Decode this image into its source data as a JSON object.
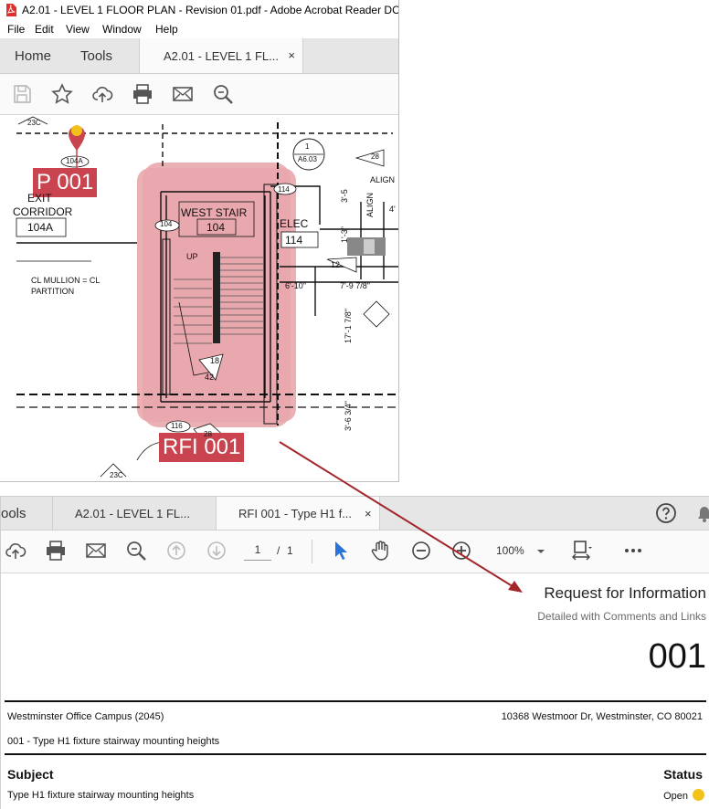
{
  "window1": {
    "title": "A2.01 - LEVEL 1 FLOOR PLAN - Revision 01.pdf - Adobe Acrobat Reader DC",
    "menu": [
      "File",
      "Edit",
      "View",
      "Window",
      "Help"
    ],
    "tabs": {
      "home": "Home",
      "tools": "Tools",
      "doc": "A2.01 - LEVEL 1 FL...",
      "close": "×"
    },
    "toolbar_icons": [
      "save-icon",
      "star-icon",
      "cloud-upload-icon",
      "print-icon",
      "mail-icon",
      "search-zoom-icon"
    ],
    "plan": {
      "markup_p": "P 001",
      "markup_rfi": "RFI 001",
      "pin_tag": "104A",
      "exit_label_1": "EXIT",
      "exit_label_2": "CORRIDOR",
      "exit_room": "104A",
      "tag_104": "104",
      "stair_name": "WEST STAIR",
      "stair_room": "104",
      "up": "UP",
      "tag_18": "18",
      "tag_42": "42",
      "tag_116": "116",
      "tag_28b": "28",
      "tag_23c": "23C",
      "tag_23c_b": "23C",
      "elec": "ELEC",
      "elec_room": "114",
      "tag_114": "114",
      "tag_12": "12",
      "tag_28": "28",
      "detail_1": "1",
      "detail_a603": "A6.03",
      "align1": "ALIGN",
      "align2": "ALIGN",
      "dim1": "6'-10\"",
      "dim2": "7'-9 7/8\"",
      "dim3": "17'-1 7/8\"",
      "dim4": "3'-6 3/4\"",
      "dim5": "4'",
      "dim6": "3'-5",
      "dim7": "1'-3\"",
      "mullion_1": "CL MULLION = CL",
      "mullion_2": "PARTITION"
    }
  },
  "window2": {
    "tabs": {
      "tools_partial": "ools",
      "tab1": "A2.01 - LEVEL 1 FL...",
      "tab2": "RFI 001 - Type H1 f...",
      "close": "×"
    },
    "toolbar": {
      "page_current": "1",
      "page_sep": "/",
      "page_total": "1",
      "zoom": "100%"
    },
    "toolbar_icons": [
      "cloud-upload-icon",
      "print-icon",
      "mail-icon",
      "search-zoom-icon",
      "arrow-up-circle-icon",
      "arrow-down-circle-icon",
      "cursor-icon",
      "hand-icon",
      "zoom-out-icon",
      "zoom-in-icon",
      "chevron-down-icon",
      "fit-page-icon",
      "more-icon",
      "help-icon",
      "bell-icon"
    ],
    "doc": {
      "title": "Request for Information",
      "subtitle": "Detailed with Comments and Links",
      "number": "001",
      "project": "Westminster Office Campus (2045)",
      "address": "10368 Westmoor Dr, Westminster, CO 80021",
      "rfi_line": "001 - Type H1 fixture stairway mounting heights",
      "subject_label": "Subject",
      "subject_value": "Type H1 fixture stairway mounting heights",
      "status_label": "Status",
      "status_value": "Open"
    }
  },
  "colors": {
    "markup": "#c9444f",
    "markup_cloud": "#e8a7ac",
    "arrow": "#a3262b",
    "status_open": "#f2c21b",
    "cursor": "#2a73d9"
  }
}
